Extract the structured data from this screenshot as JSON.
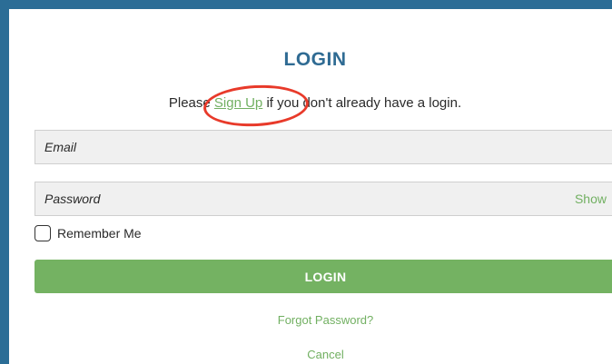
{
  "login": {
    "title": "LOGIN",
    "signup_prefix": "Please ",
    "signup_link": "Sign Up",
    "signup_suffix": " if you don't already have a login.",
    "email_placeholder": "Email",
    "password_placeholder": "Password",
    "show_label": "Show",
    "remember_label": "Remember Me",
    "button_label": "LOGIN",
    "forgot_label": "Forgot Password?",
    "cancel_label": "Cancel"
  },
  "colors": {
    "frame": "#2b6d96",
    "title": "#2f6b93",
    "accent_green": "#74b262",
    "annotation_red": "#e83a2a"
  }
}
